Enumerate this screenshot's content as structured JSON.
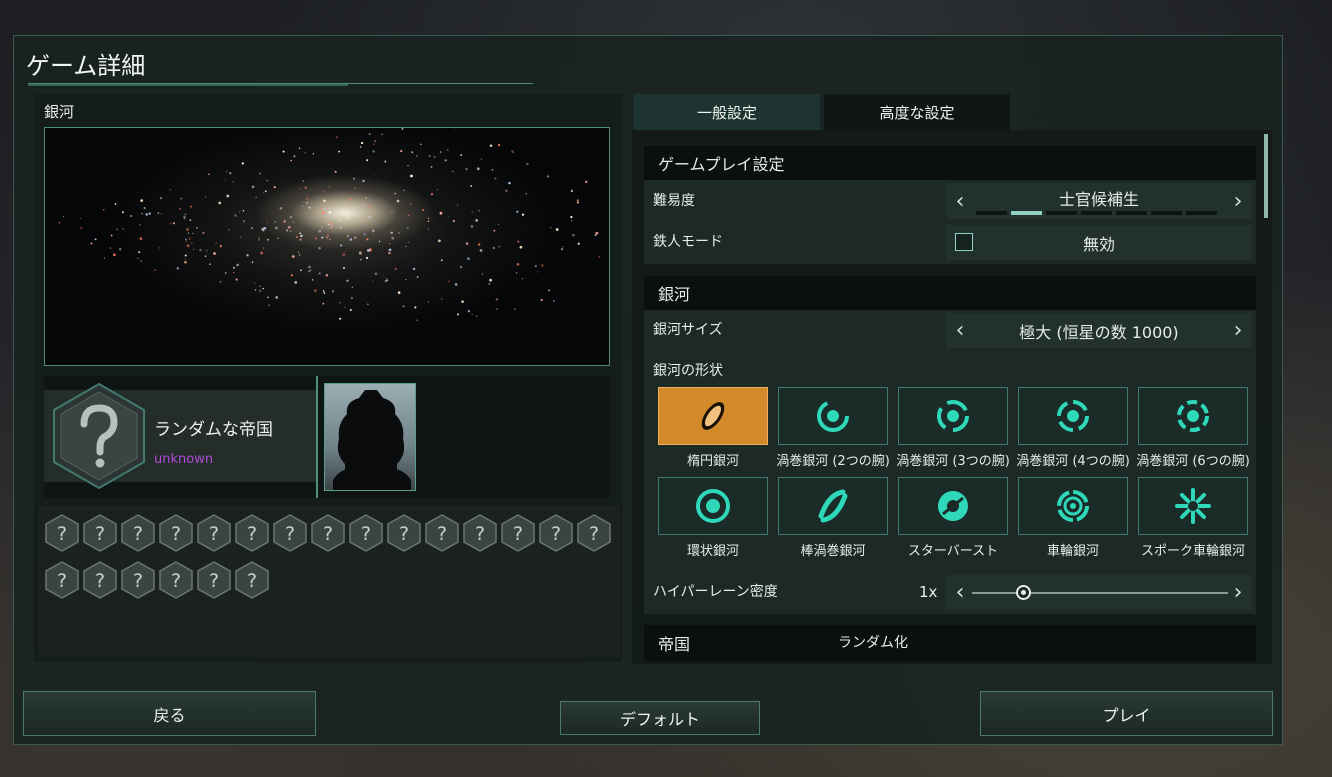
{
  "window": {
    "title": "ゲーム詳細"
  },
  "left": {
    "galaxy_label": "銀河",
    "empire_name": "ランダムな帝国",
    "empire_sub": "unknown",
    "big_hex_icon": "question-hex-icon",
    "slot_count": 21,
    "slot_glyph": "?"
  },
  "tabs": [
    {
      "label": "一般設定",
      "active": true
    },
    {
      "label": "高度な設定",
      "active": false
    }
  ],
  "gameplay": {
    "header": "ゲームプレイ設定",
    "difficulty_label": "難易度",
    "difficulty_value": "士官候補生",
    "difficulty_level": 2,
    "difficulty_levels": 7,
    "ironman_label": "鉄人モード",
    "ironman_value": "無効",
    "arrow_left": "‹",
    "arrow_right": "›"
  },
  "galaxy": {
    "header": "銀河",
    "size_label": "銀河サイズ",
    "size_value": "極大 (恒星の数 1000)",
    "shape_label": "銀河の形状",
    "shapes": [
      {
        "label": "楕円銀河",
        "icon": "elliptical-icon",
        "selected": true
      },
      {
        "label": "渦巻銀河 (2つの腕)",
        "icon": "spiral-2-icon",
        "selected": false
      },
      {
        "label": "渦巻銀河 (3つの腕)",
        "icon": "spiral-3-icon",
        "selected": false
      },
      {
        "label": "渦巻銀河 (4つの腕)",
        "icon": "spiral-4-icon",
        "selected": false
      },
      {
        "label": "渦巻銀河 (6つの腕)",
        "icon": "spiral-6-icon",
        "selected": false
      },
      {
        "label": "環状銀河",
        "icon": "ring-icon",
        "selected": false
      },
      {
        "label": "棒渦巻銀河",
        "icon": "barred-spiral-icon",
        "selected": false
      },
      {
        "label": "スターバースト",
        "icon": "starburst-icon",
        "selected": false
      },
      {
        "label": "車輪銀河",
        "icon": "cartwheel-icon",
        "selected": false
      },
      {
        "label": "スポーク車輪銀河",
        "icon": "spoked-wheel-icon",
        "selected": false
      }
    ],
    "hyperlane_label": "ハイパーレーン密度",
    "hyperlane_value": "1x",
    "hyperlane_fraction": 0.2
  },
  "empires": {
    "header": "帝国",
    "randomize": "ランダム化"
  },
  "buttons": {
    "back": "戻る",
    "default": "デフォルト",
    "play": "プレイ"
  },
  "colors": {
    "accent": "#2fd8b8",
    "selected": "#d28a2a",
    "purple": "#b04ad8"
  }
}
